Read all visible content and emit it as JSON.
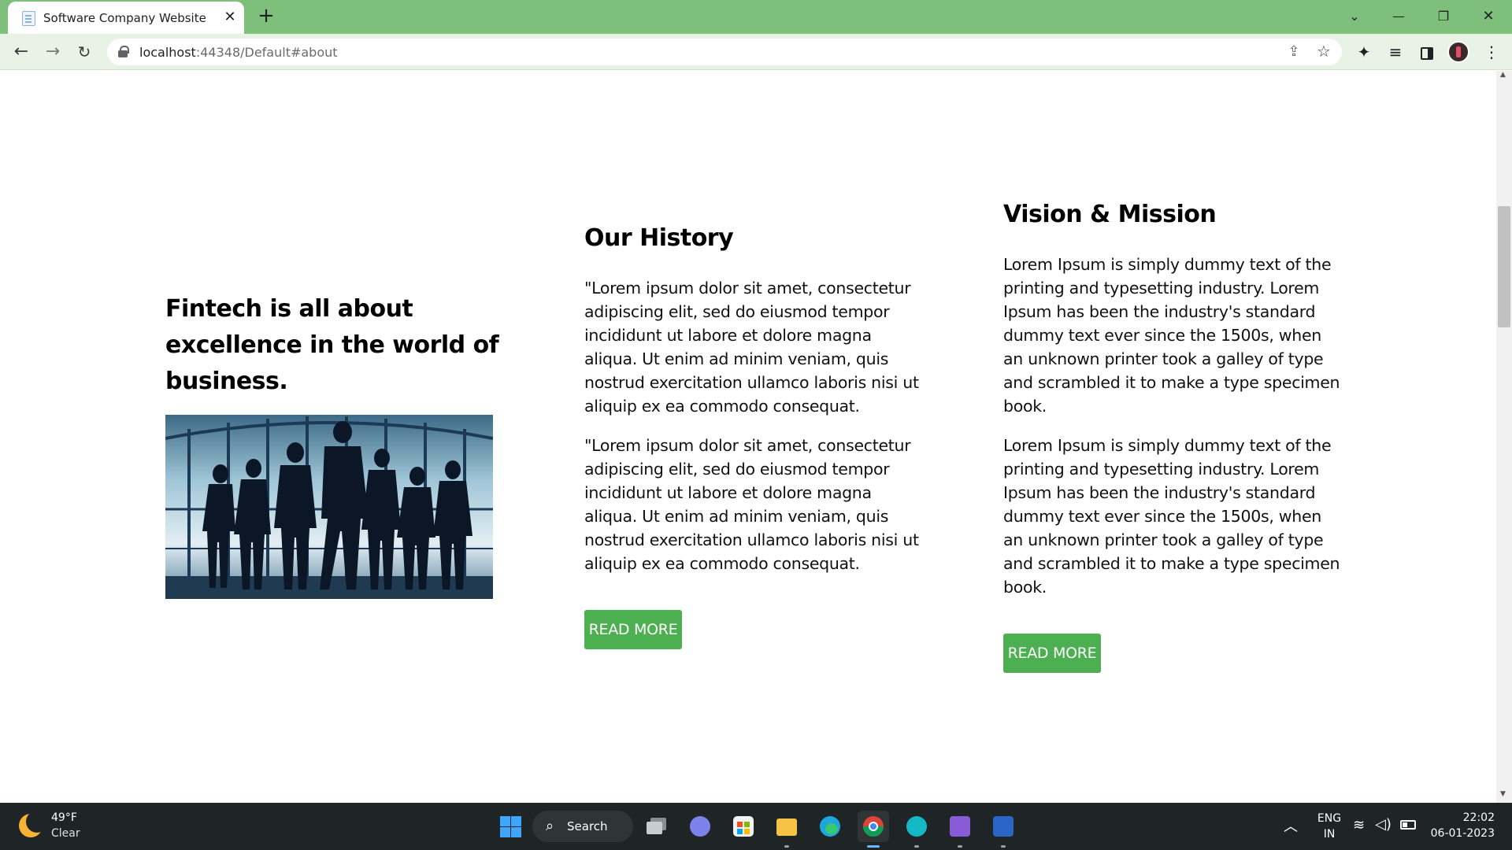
{
  "browser": {
    "tab_title": "Software Company Website",
    "url_host": "localhost",
    "url_rest": ":44348/Default#about",
    "tab_close_symbol": "✕",
    "new_tab_symbol": "+"
  },
  "about": {
    "intro_heading": "Fintech is all about excellence in the world of business.",
    "history": {
      "heading": "Our History",
      "paragraphs": [
        "\"Lorem ipsum dolor sit amet, consectetur adipiscing elit, sed do eiusmod tempor incididunt ut labore et dolore magna aliqua. Ut enim ad minim veniam, quis nostrud exercitation ullamco laboris nisi ut aliquip ex ea commodo consequat.",
        "\"Lorem ipsum dolor sit amet, consectetur adipiscing elit, sed do eiusmod tempor incididunt ut labore et dolore magna aliqua. Ut enim ad minim veniam, quis nostrud exercitation ullamco laboris nisi ut aliquip ex ea commodo consequat."
      ],
      "button_label": "READ MORE"
    },
    "vision": {
      "heading": "Vision & Mission",
      "paragraphs": [
        "Lorem Ipsum is simply dummy text of the printing and typesetting industry. Lorem Ipsum has been the industry's standard dummy text ever since the 1500s, when an unknown printer took a galley of type and scrambled it to make a type specimen book.",
        "Lorem Ipsum is simply dummy text of the printing and typesetting industry. Lorem Ipsum has been the industry's standard dummy text ever since the 1500s, when an unknown printer took a galley of type and scrambled it to make a type specimen book."
      ],
      "button_label": "READ MORE"
    },
    "accent_color": "#4caf50"
  },
  "taskbar": {
    "weather_temp": "49°F",
    "weather_desc": "Clear",
    "search_label": "Search",
    "lang_line1": "ENG",
    "lang_line2": "IN",
    "time": "22:02",
    "date": "06-01-2023",
    "apps": [
      "start-button",
      "task-view-icon",
      "chat-icon",
      "store-icon",
      "file-explorer-icon",
      "edge-icon",
      "chrome-icon",
      "canva-icon",
      "visual-studio-icon",
      "word-icon"
    ]
  },
  "colors": {
    "chrome_frame": "#7dbf7b",
    "toolbar": "#e8f3e6",
    "taskbar": "#1f2426"
  }
}
